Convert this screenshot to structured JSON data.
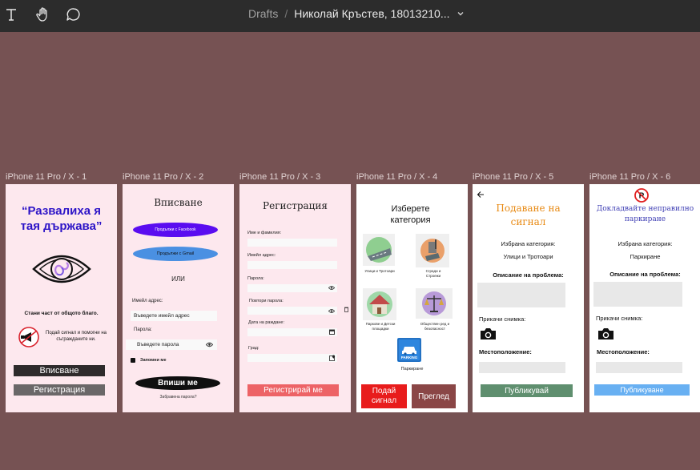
{
  "toolbar": {
    "text_tool_icon": "text-icon",
    "hand_tool_icon": "hand-icon",
    "comment_tool_icon": "comment-icon",
    "breadcrumb_parent": "Drafts",
    "breadcrumb_separator": "/",
    "file_name": "Николай Кръстев, 18013210..."
  },
  "frames": [
    {
      "label": "iPhone 11 Pro / X - 1",
      "quote": "“Развалиха я тая държава”",
      "tagline": "Стани част от общото благо.",
      "info_text": "Подай сигнал и помогни на съгражданите ни.",
      "login_button": "Вписване",
      "register_button": "Регистрация"
    },
    {
      "label": "iPhone 11 Pro / X - 2",
      "title": "Вписване",
      "facebook_button": "Продължи с Facebook",
      "gmail_button": "Продължи с Gmail",
      "or_text": "ИЛИ",
      "email_label": "Имейл адрес:",
      "email_placeholder": "Въведете имейл адрес",
      "password_label": "Парола:",
      "password_placeholder": "Въведете парола",
      "remember_me": "Запомни ме",
      "submit_button": "Впиши ме",
      "forgot_password": "Забравена парола?"
    },
    {
      "label": "iPhone 11 Pro / X - 3",
      "title": "Регистрация",
      "fields": [
        "Име и фамилия:",
        "Имейл адрес:",
        "Парола:",
        "Повтори парола:",
        "Дата на раждане:",
        "Град:"
      ],
      "submit_button": "Регистрирай ме"
    },
    {
      "label": "iPhone 11 Pro / X - 4",
      "title": "Изберете категория",
      "categories": [
        {
          "name": "Улици и Тротоари",
          "icon": "street-icon"
        },
        {
          "name": "Сгради и Строежи",
          "icon": "construction-icon"
        },
        {
          "name": "Паркове и Детски площадки",
          "icon": "park-icon"
        },
        {
          "name": "Обществен ред и безопасност",
          "icon": "justice-scale-icon"
        },
        {
          "name": "Паркиране",
          "icon": "parking-icon"
        }
      ],
      "parking_sign_text": "PARKING",
      "report_button": "Подай сигнал",
      "review_button": "Преглед"
    },
    {
      "label": "iPhone 11 Pro / X - 5",
      "title": "Подаване на сигнал",
      "selected_category_label": "Избрана категория:",
      "selected_category_value": "Улици и Тротоари",
      "description_label": "Описание на проблема:",
      "attach_photo_label": "Прикачи снимка:",
      "location_label": "Местоположение:",
      "publish_button": "Публикувай"
    },
    {
      "label": "iPhone 11 Pro / X - 6",
      "title": "Докладвайте неправилно паркиране",
      "selected_category_label": "Избрана категория:",
      "selected_category_value": "Паркиране",
      "description_label": "Описание на проблема:",
      "attach_photo_label": "Прикачи снимка:",
      "location_label": "Местоположение:",
      "publish_button": "Публикуване"
    }
  ],
  "colors": {
    "canvas": "#765253",
    "toolbar": "#2c2c2c",
    "frame_pink": "#fde8ee",
    "quote_blue": "#2d14c7",
    "dark_button": "#2e2a2b",
    "facebook_purple": "#5a0df0",
    "gmail_blue": "#4a90e2",
    "register_red": "#ed6366",
    "report_red": "#e81c1c",
    "review_maroon": "#8a4646",
    "title_orange": "#e88a14",
    "publish_green": "#5f8f6f",
    "publish_blue": "#68b0f2"
  }
}
